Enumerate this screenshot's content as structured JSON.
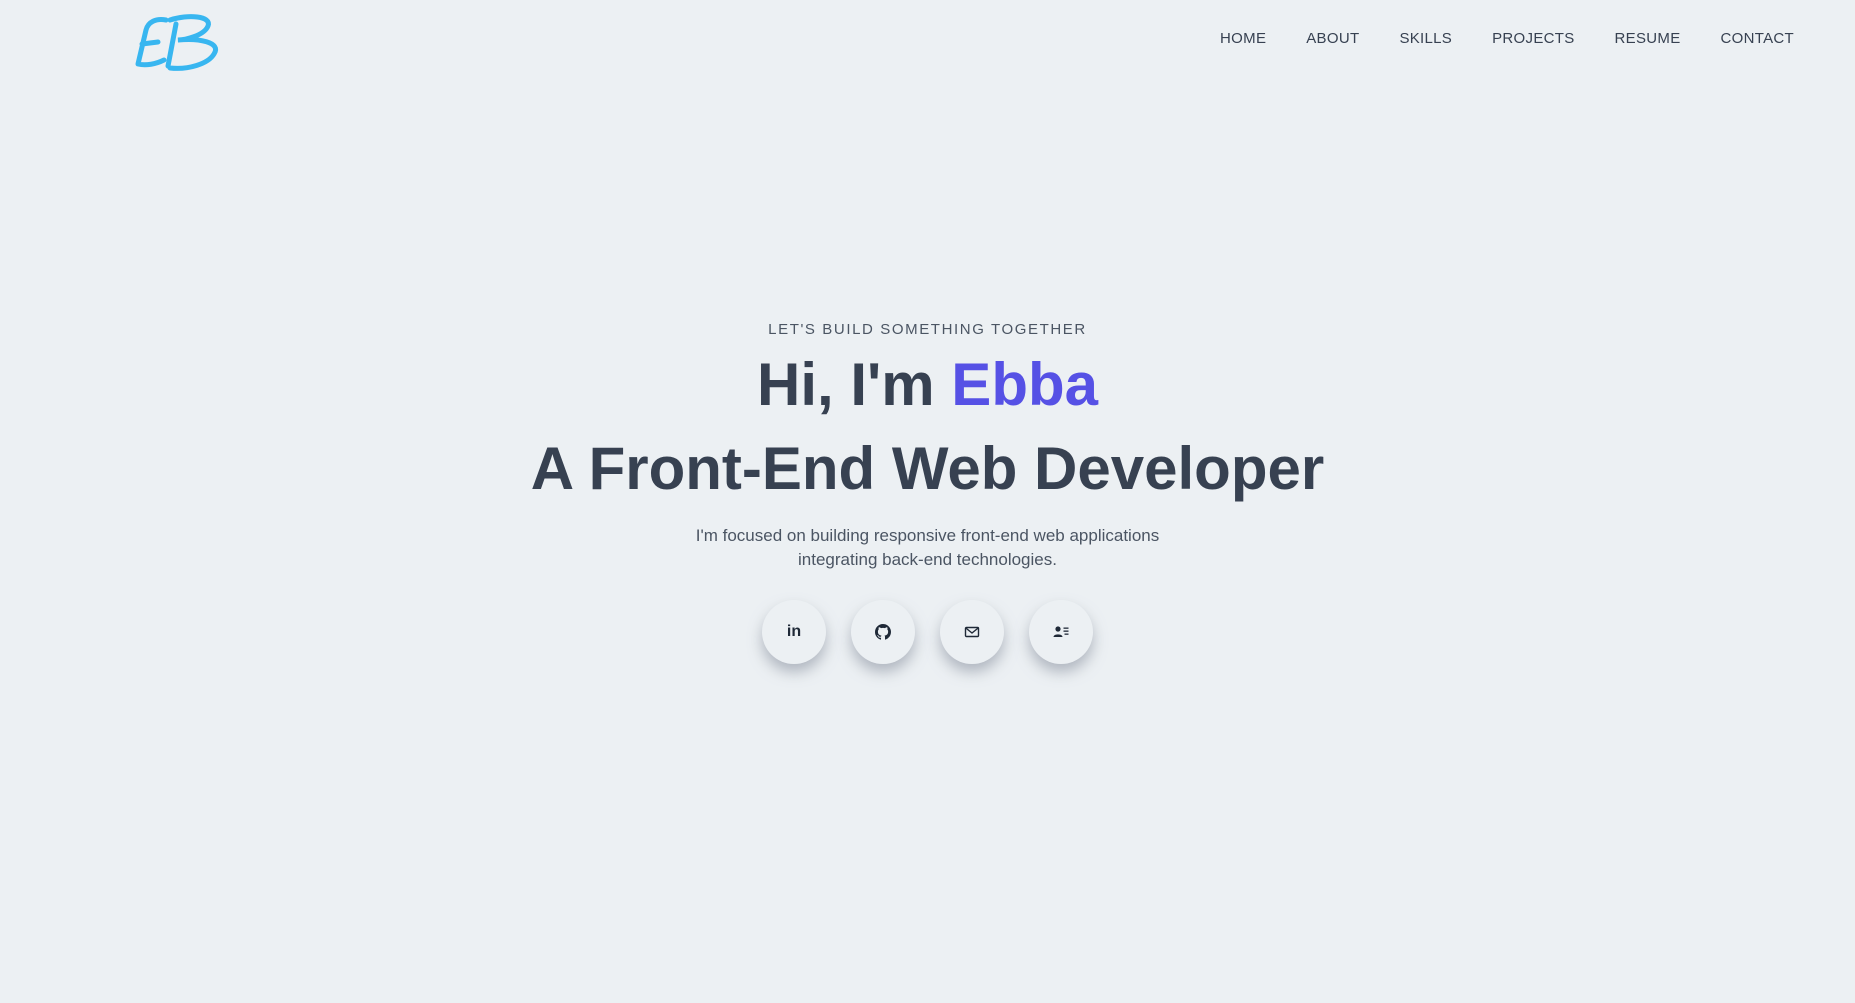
{
  "logo": {
    "text": "EB",
    "color": "#38b6f0"
  },
  "nav": {
    "items": [
      {
        "label": "HOME"
      },
      {
        "label": "ABOUT"
      },
      {
        "label": "SKILLS"
      },
      {
        "label": "PROJECTS"
      },
      {
        "label": "RESUME"
      },
      {
        "label": "CONTACT"
      }
    ]
  },
  "hero": {
    "eyebrow": "LET'S BUILD SOMETHING TOGETHER",
    "greeting": "Hi, I'm ",
    "name": "Ebba",
    "role": "A Front-End Web Developer",
    "description": "I'm focused on building responsive front-end web applications integrating back-end technologies."
  },
  "socials": [
    {
      "icon": "linkedin-icon",
      "text": "in"
    },
    {
      "icon": "github-icon"
    },
    {
      "icon": "mail-icon"
    },
    {
      "icon": "contact-card-icon"
    }
  ],
  "colors": {
    "background": "#ecf0f3",
    "text": "#374151",
    "accent": "#5651e5",
    "logo": "#38b6f0"
  }
}
